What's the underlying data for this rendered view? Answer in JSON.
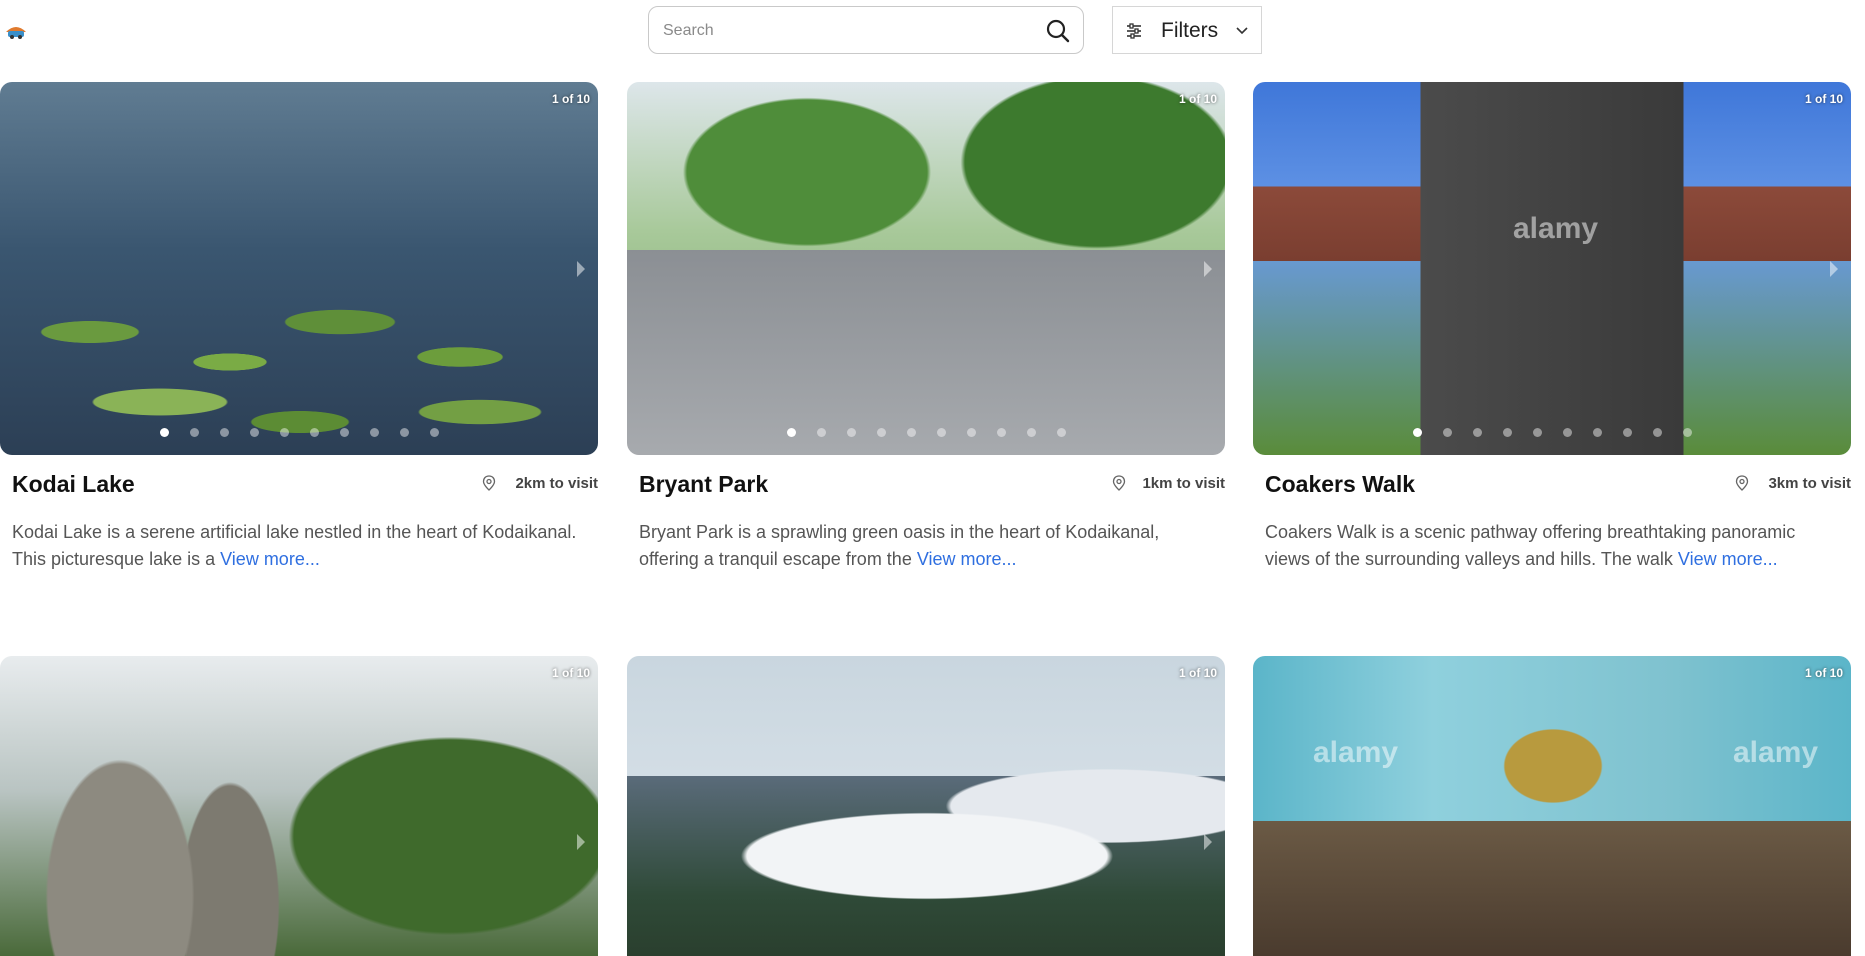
{
  "header": {
    "logo_name": "app-logo",
    "search": {
      "placeholder": "Search",
      "value": ""
    },
    "filters_label": "Filters"
  },
  "cards": [
    {
      "title": "Kodai Lake",
      "distance": "2km to visit",
      "counter": "1 of 10",
      "description": "Kodai Lake is a serene artificial lake nestled in the heart of Kodaikanal. This picturesque lake is a",
      "more": "View more...",
      "dots": 10,
      "active_dot": 0
    },
    {
      "title": "Bryant Park",
      "distance": "1km to visit",
      "counter": "1 of 10",
      "description": "Bryant Park is a sprawling green oasis in the heart of Kodaikanal, offering a tranquil escape from the",
      "more": "View more...",
      "dots": 10,
      "active_dot": 0
    },
    {
      "title": "Coakers Walk",
      "distance": "3km to visit",
      "counter": "1 of 10",
      "description": "Coakers Walk is a scenic pathway offering breathtaking panoramic views of the surrounding valleys and hills. The walk",
      "more": "View more...",
      "dots": 10,
      "active_dot": 0,
      "watermark": "alamy"
    },
    {
      "counter": "1 of 10"
    },
    {
      "counter": "1 of 10"
    },
    {
      "counter": "1 of 10",
      "watermark": "alamy"
    }
  ],
  "colors": {
    "link": "#2f6fe0",
    "text_muted": "#555555",
    "title": "#111111"
  }
}
